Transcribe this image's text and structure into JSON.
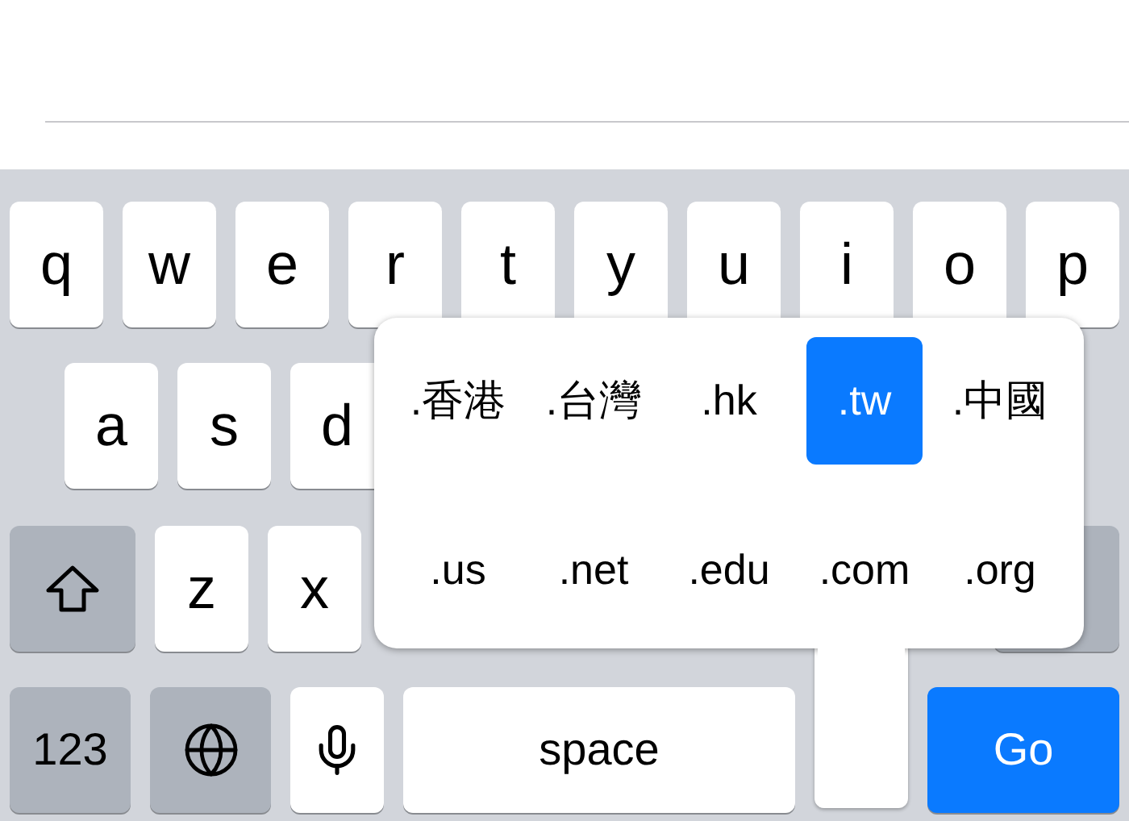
{
  "keyboard": {
    "rows": [
      {
        "keys": [
          {
            "kind": "letter",
            "label": "q"
          },
          {
            "kind": "letter",
            "label": "w"
          },
          {
            "kind": "letter",
            "label": "e"
          },
          {
            "kind": "letter",
            "label": "r"
          },
          {
            "kind": "letter",
            "label": "t"
          },
          {
            "kind": "letter",
            "label": "y"
          },
          {
            "kind": "letter",
            "label": "u"
          },
          {
            "kind": "letter",
            "label": "i"
          },
          {
            "kind": "letter",
            "label": "o"
          },
          {
            "kind": "letter",
            "label": "p"
          }
        ]
      },
      {
        "keys": [
          {
            "kind": "letter",
            "label": "a"
          },
          {
            "kind": "letter",
            "label": "s"
          },
          {
            "kind": "letter",
            "label": "d"
          }
        ]
      },
      {
        "keys": [
          {
            "kind": "shift"
          },
          {
            "kind": "letter",
            "label": "z"
          },
          {
            "kind": "letter",
            "label": "x"
          },
          {
            "kind": "gap"
          },
          {
            "kind": "delete"
          }
        ]
      },
      {
        "keys": [
          {
            "kind": "numbers",
            "label": "123"
          },
          {
            "kind": "globe"
          },
          {
            "kind": "mic"
          },
          {
            "kind": "space",
            "label": "space"
          },
          {
            "kind": "pressed"
          },
          {
            "kind": "go",
            "label": "Go"
          }
        ]
      }
    ]
  },
  "domain_popup": {
    "options": [
      {
        "label": ".香港",
        "selected": false
      },
      {
        "label": ".台灣",
        "selected": false
      },
      {
        "label": ".hk",
        "selected": false
      },
      {
        "label": ".tw",
        "selected": true
      },
      {
        "label": ".中國",
        "selected": false
      },
      {
        "label": ".us",
        "selected": false
      },
      {
        "label": ".net",
        "selected": false
      },
      {
        "label": ".edu",
        "selected": false
      },
      {
        "label": ".com",
        "selected": false
      },
      {
        "label": ".org",
        "selected": false
      }
    ]
  }
}
